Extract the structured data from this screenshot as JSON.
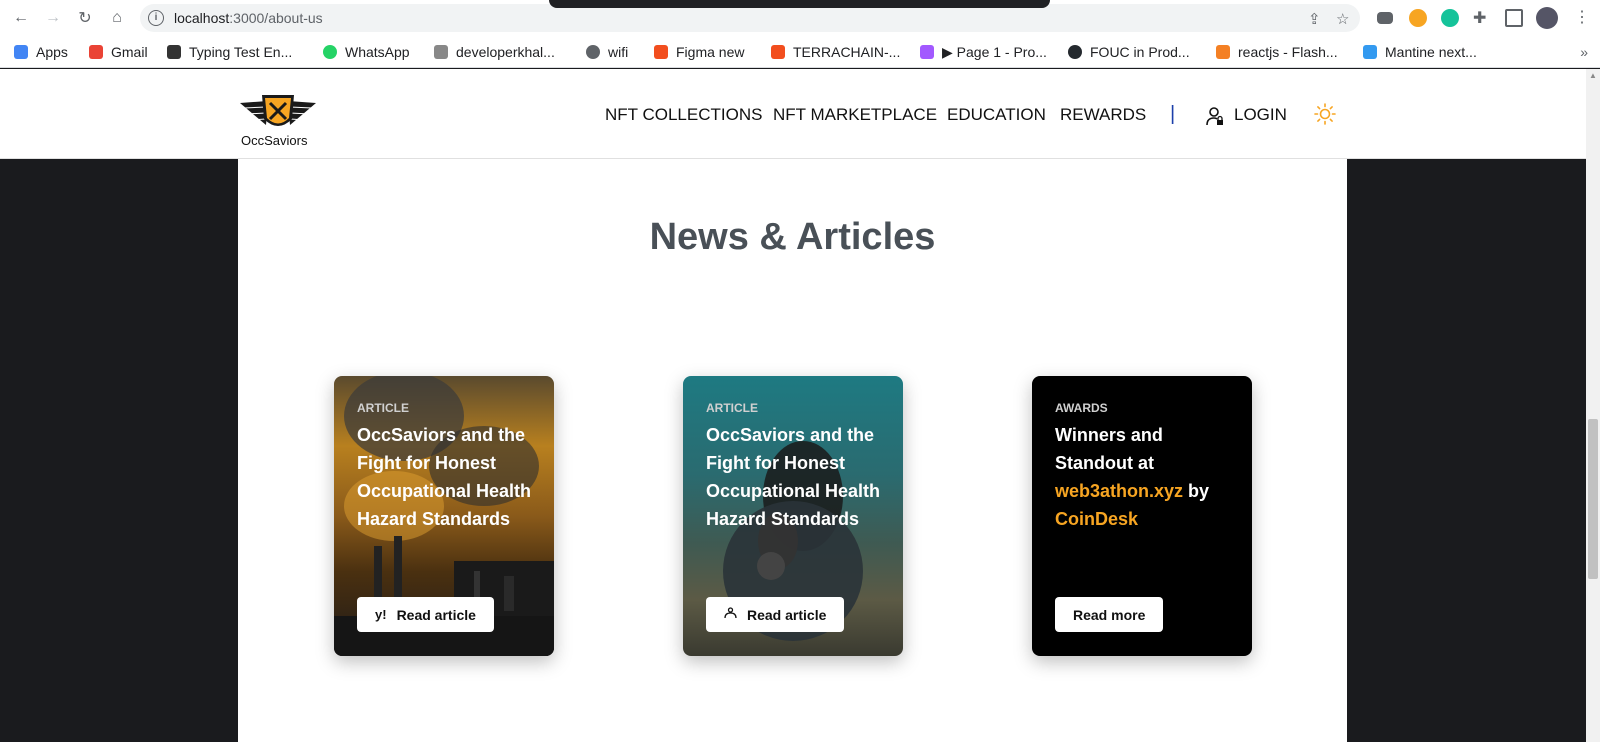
{
  "browser": {
    "url_host": "localhost",
    "url_path": ":3000/about-us",
    "bookmarks": [
      {
        "label": "Apps",
        "color": "#4285f4"
      },
      {
        "label": "Gmail",
        "color": "#ea4335"
      },
      {
        "label": "Typing Test En...",
        "color": "#333333"
      },
      {
        "label": "WhatsApp",
        "color": "#25d366"
      },
      {
        "label": "developerkhal...",
        "color": "#888888"
      },
      {
        "label": "wifi",
        "color": "#5f6368"
      },
      {
        "label": "Figma new",
        "color": "#f24e1e"
      },
      {
        "label": "TERRACHAIN-...",
        "color": "#f24e1e"
      },
      {
        "label": "▶ Page 1 - Pro...",
        "color": "#a259ff"
      },
      {
        "label": "FOUC in Prod...",
        "color": "#24292e"
      },
      {
        "label": "reactjs - Flash...",
        "color": "#f48024"
      },
      {
        "label": "Mantine next...",
        "color": "#339af0"
      }
    ],
    "more": "»"
  },
  "header": {
    "logo_text": "OccSaviors",
    "nav": [
      "NFT COLLECTIONS",
      "NFT MARKETPLACE",
      "EDUCATION",
      "REWARDS"
    ],
    "divider": "|",
    "login": "LOGIN"
  },
  "section": {
    "title": "News & Articles",
    "cards": [
      {
        "label": "ARTICLE",
        "title": "OccSaviors and the Fight for Honest Occupational Health Hazard Standards",
        "button": "Read article",
        "button_icon": "y!",
        "background": "factory-smoke"
      },
      {
        "label": "ARTICLE",
        "title": "OccSaviors and the Fight for Honest Occupational Health Hazard Standards",
        "button": "Read article",
        "button_icon": "hands-icon",
        "background": "gas-mask"
      },
      {
        "label": "AWARDS",
        "title_before": "Winners and Standout at",
        "title_link": "web3athon.xyz",
        "title_mid": "by",
        "title_brand": "CoinDesk",
        "button": "Read more",
        "background": "black"
      }
    ]
  },
  "colors": {
    "accent": "#f7a522",
    "page_bg": "#1a1b1e",
    "divider_blue": "#1c3faa"
  }
}
